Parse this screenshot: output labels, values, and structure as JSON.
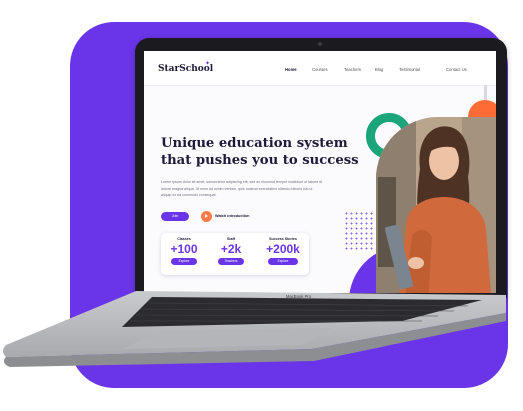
{
  "colors": {
    "brand": "#6a35e8",
    "accent_orange": "#ff7a45",
    "accent_green": "#1aa57a",
    "heading": "#1e1b3a"
  },
  "site": {
    "logo": "StarSchool",
    "nav": [
      "Home",
      "Courses",
      "Teachers",
      "Blog",
      "Testimonial",
      "Contact Us"
    ],
    "active_nav": "Home",
    "headline": [
      "Unique education system",
      "that pushes you to success"
    ],
    "paragraph_lines": [
      "Lorem ipsum dolor sit amet, consectetur adipiscing elit, sed do eiusmod tempor incididunt ut labore et",
      "dolore magna aliqua. Ut enim ad minim veniam, quis nostrud exercitation ullamco laboris nisi ut",
      "aliquip ex ea commodo consequat."
    ],
    "join_label": "Join",
    "watch_label": "Watch introduction",
    "stats": [
      {
        "label": "Classes",
        "value": "+100",
        "button": "Explore"
      },
      {
        "label": "Staff",
        "value": "+2k",
        "button": "Teachers"
      },
      {
        "label": "Success Stories",
        "value": "+200k",
        "button": "Explore"
      }
    ]
  },
  "device": {
    "label": "MacBook Pro"
  }
}
